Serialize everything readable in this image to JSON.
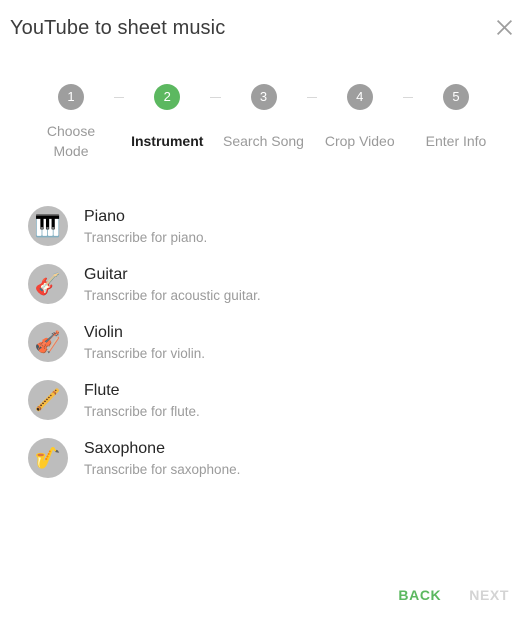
{
  "header": {
    "title": "YouTube to sheet music",
    "close_icon": "close-icon"
  },
  "stepper": {
    "active_index": 1,
    "active_color": "#5cb860",
    "inactive_color": "#9e9e9e",
    "steps": [
      {
        "number": "1",
        "label": "Choose Mode"
      },
      {
        "number": "2",
        "label": "Instrument"
      },
      {
        "number": "3",
        "label": "Search Song"
      },
      {
        "number": "4",
        "label": "Crop Video"
      },
      {
        "number": "5",
        "label": "Enter Info"
      }
    ]
  },
  "instruments": [
    {
      "icon": "🎹",
      "icon_name": "piano-icon",
      "name": "Piano",
      "description": "Transcribe for piano."
    },
    {
      "icon": "🎸",
      "icon_name": "guitar-icon",
      "name": "Guitar",
      "description": "Transcribe for acoustic guitar."
    },
    {
      "icon": "🎻",
      "icon_name": "violin-icon",
      "name": "Violin",
      "description": "Transcribe for violin."
    },
    {
      "icon": "🪈",
      "icon_name": "flute-icon",
      "name": "Flute",
      "description": "Transcribe for flute."
    },
    {
      "icon": "🎷",
      "icon_name": "saxophone-icon",
      "name": "Saxophone",
      "description": "Transcribe for saxophone."
    }
  ],
  "actions": {
    "back_label": "BACK",
    "next_label": "NEXT",
    "back_color": "#5cb860",
    "next_color": "#d4d4d4"
  }
}
